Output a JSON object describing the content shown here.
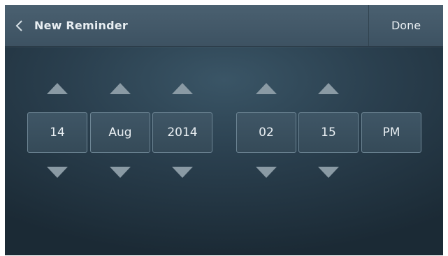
{
  "header": {
    "title": "New Reminder",
    "done_label": "Done"
  },
  "date": {
    "day": "14",
    "month": "Aug",
    "year": "2014"
  },
  "time": {
    "hour": "02",
    "minute": "15",
    "period": "PM"
  },
  "colors": {
    "arrow": "#8a9aa4",
    "text": "#e8eef2",
    "field_border": "#6f8796"
  },
  "icons": {
    "back": "chevron-left-icon",
    "increment": "triangle-up-icon",
    "decrement": "triangle-down-icon"
  }
}
